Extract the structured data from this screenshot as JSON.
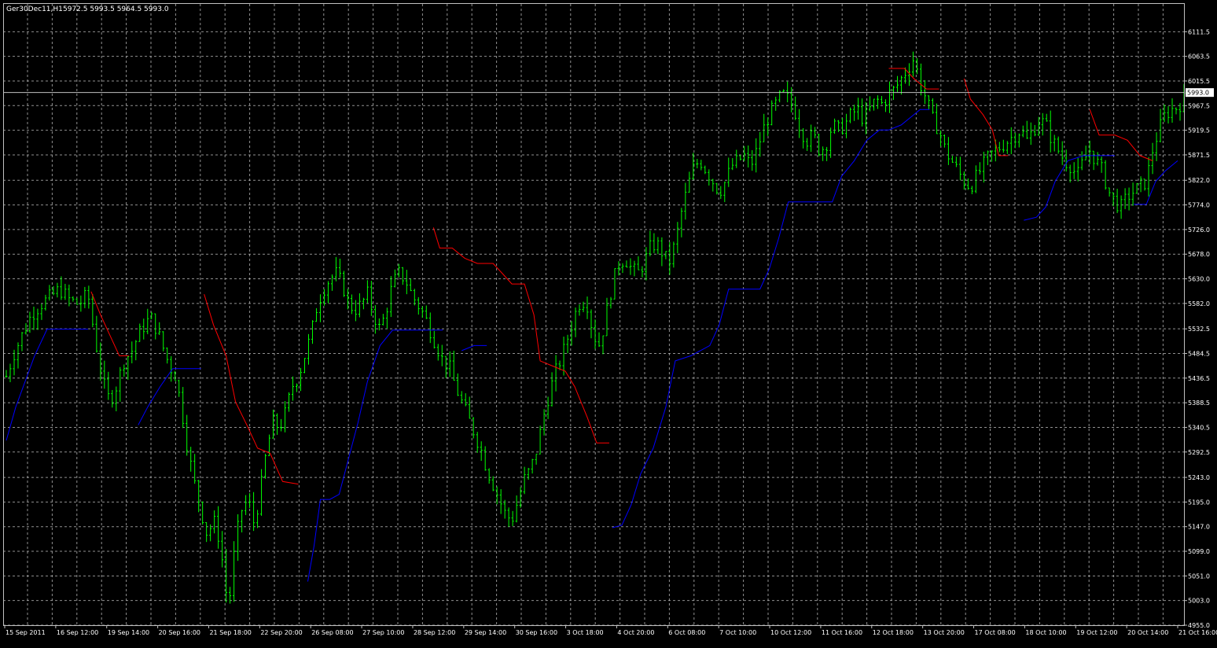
{
  "header": {
    "symbol": "Ger30Dec11,H1",
    "ohlc": "5972.5 5993.5 5964.5 5993.0"
  },
  "colors": {
    "background": "#000000",
    "grid": "#c0c0c0",
    "bars": "#00ff00",
    "bid_line": "#c0c0c0",
    "price_tag_bg": "#ffffff",
    "stop_up": "#0000ff",
    "stop_down": "#ff0000",
    "axis_text": "#ffffff"
  },
  "chart_data": {
    "type": "line",
    "title": "Ger30Dec11,H1",
    "timeframe": "H1",
    "ylim": [
      4955.0,
      6135.0
    ],
    "grid": true,
    "y_ticks": [
      "6111.5",
      "6063.5",
      "6015.5",
      "5967.5",
      "5919.5",
      "5871.5",
      "5822.0",
      "5774.0",
      "5726.0",
      "5678.0",
      "5630.0",
      "5582.0",
      "5532.5",
      "5484.5",
      "5436.5",
      "5388.5",
      "5340.5",
      "5292.5",
      "5243.0",
      "5195.0",
      "5147.0",
      "5099.0",
      "5051.0",
      "5003.0",
      "4955.0"
    ],
    "x_ticks": [
      "15 Sep 2011",
      "16 Sep 12:00",
      "19 Sep 14:00",
      "20 Sep 16:00",
      "21 Sep 18:00",
      "22 Sep 20:00",
      "26 Sep 08:00",
      "27 Sep 10:00",
      "28 Sep 12:00",
      "29 Sep 14:00",
      "30 Sep 16:00",
      "3 Oct 18:00",
      "4 Oct 20:00",
      "6 Oct 08:00",
      "7 Oct 10:00",
      "10 Oct 12:00",
      "11 Oct 16:00",
      "12 Oct 18:00",
      "13 Oct 20:00",
      "17 Oct 08:00",
      "18 Oct 10:00",
      "19 Oct 12:00",
      "20 Oct 14:00",
      "21 Oct 16:00"
    ],
    "current_price": "5993.0",
    "bar_count": 300,
    "close_path": [
      [
        0,
        5440
      ],
      [
        5,
        5485
      ],
      [
        10,
        5520
      ],
      [
        16,
        5560
      ],
      [
        22,
        5580
      ],
      [
        28,
        5595
      ],
      [
        34,
        5610
      ],
      [
        40,
        5590
      ],
      [
        46,
        5580
      ],
      [
        52,
        5600
      ],
      [
        57,
        5505
      ],
      [
        62,
        5425
      ],
      [
        66,
        5390
      ],
      [
        70,
        5420
      ],
      [
        75,
        5470
      ],
      [
        80,
        5490
      ],
      [
        84,
        5520
      ],
      [
        88,
        5540
      ],
      [
        92,
        5555
      ],
      [
        96,
        5530
      ],
      [
        100,
        5495
      ],
      [
        104,
        5460
      ],
      [
        108,
        5440
      ],
      [
        112,
        5370
      ],
      [
        116,
        5290
      ],
      [
        120,
        5230
      ],
      [
        124,
        5180
      ],
      [
        128,
        5130
      ],
      [
        132,
        5160
      ],
      [
        136,
        5120
      ],
      [
        140,
        5020
      ],
      [
        142,
        5000
      ],
      [
        146,
        5120
      ],
      [
        150,
        5180
      ],
      [
        154,
        5200
      ],
      [
        158,
        5150
      ],
      [
        162,
        5220
      ],
      [
        166,
        5300
      ],
      [
        170,
        5350
      ],
      [
        174,
        5340
      ],
      [
        178,
        5370
      ],
      [
        182,
        5420
      ],
      [
        186,
        5440
      ],
      [
        190,
        5480
      ],
      [
        194,
        5520
      ],
      [
        198,
        5580
      ],
      [
        202,
        5610
      ],
      [
        206,
        5630
      ],
      [
        210,
        5640
      ],
      [
        214,
        5620
      ],
      [
        218,
        5580
      ],
      [
        222,
        5570
      ],
      [
        226,
        5580
      ],
      [
        230,
        5600
      ],
      [
        234,
        5560
      ],
      [
        238,
        5530
      ],
      [
        242,
        5570
      ],
      [
        246,
        5620
      ],
      [
        250,
        5640
      ],
      [
        254,
        5630
      ],
      [
        258,
        5600
      ],
      [
        262,
        5580
      ],
      [
        266,
        5560
      ],
      [
        270,
        5530
      ],
      [
        274,
        5500
      ],
      [
        278,
        5470
      ],
      [
        282,
        5460
      ],
      [
        286,
        5420
      ],
      [
        290,
        5390
      ],
      [
        294,
        5360
      ],
      [
        298,
        5330
      ],
      [
        302,
        5300
      ],
      [
        306,
        5260
      ],
      [
        310,
        5230
      ],
      [
        314,
        5200
      ],
      [
        318,
        5170
      ],
      [
        322,
        5160
      ],
      [
        326,
        5200
      ],
      [
        330,
        5240
      ],
      [
        334,
        5260
      ],
      [
        338,
        5300
      ],
      [
        342,
        5360
      ],
      [
        346,
        5410
      ],
      [
        350,
        5450
      ],
      [
        354,
        5480
      ],
      [
        358,
        5520
      ],
      [
        362,
        5560
      ],
      [
        366,
        5590
      ],
      [
        370,
        5580
      ],
      [
        374,
        5520
      ],
      [
        378,
        5500
      ],
      [
        382,
        5560
      ],
      [
        386,
        5620
      ],
      [
        390,
        5660
      ],
      [
        394,
        5670
      ],
      [
        398,
        5650
      ],
      [
        402,
        5640
      ],
      [
        406,
        5660
      ],
      [
        410,
        5690
      ],
      [
        414,
        5700
      ],
      [
        418,
        5680
      ],
      [
        422,
        5660
      ],
      [
        426,
        5700
      ],
      [
        430,
        5760
      ],
      [
        434,
        5810
      ],
      [
        438,
        5850
      ],
      [
        442,
        5860
      ],
      [
        446,
        5840
      ],
      [
        450,
        5820
      ],
      [
        454,
        5800
      ],
      [
        458,
        5820
      ],
      [
        462,
        5850
      ],
      [
        466,
        5860
      ],
      [
        470,
        5870
      ],
      [
        474,
        5850
      ],
      [
        478,
        5880
      ],
      [
        482,
        5920
      ],
      [
        486,
        5950
      ],
      [
        490,
        5970
      ],
      [
        494,
        5990
      ],
      [
        498,
        5980
      ],
      [
        502,
        5960
      ],
      [
        506,
        5920
      ],
      [
        510,
        5900
      ],
      [
        514,
        5910
      ],
      [
        518,
        5880
      ],
      [
        522,
        5890
      ],
      [
        526,
        5930
      ],
      [
        530,
        5920
      ],
      [
        534,
        5930
      ],
      [
        538,
        5950
      ],
      [
        542,
        5960
      ],
      [
        546,
        5940
      ],
      [
        550,
        5960
      ],
      [
        554,
        5980
      ],
      [
        558,
        5970
      ],
      [
        562,
        5990
      ],
      [
        566,
        6000
      ],
      [
        570,
        6020
      ],
      [
        574,
        6040
      ],
      [
        578,
        6060
      ],
      [
        582,
        6010
      ],
      [
        586,
        5980
      ],
      [
        590,
        5940
      ],
      [
        594,
        5920
      ],
      [
        598,
        5880
      ],
      [
        602,
        5860
      ],
      [
        606,
        5840
      ],
      [
        610,
        5820
      ],
      [
        614,
        5810
      ],
      [
        618,
        5830
      ],
      [
        622,
        5850
      ],
      [
        626,
        5870
      ],
      [
        630,
        5880
      ],
      [
        634,
        5890
      ],
      [
        638,
        5900
      ],
      [
        642,
        5910
      ],
      [
        646,
        5920
      ],
      [
        650,
        5900
      ],
      [
        654,
        5920
      ],
      [
        658,
        5940
      ],
      [
        662,
        5930
      ],
      [
        666,
        5900
      ],
      [
        670,
        5880
      ],
      [
        674,
        5860
      ],
      [
        678,
        5850
      ],
      [
        682,
        5830
      ],
      [
        686,
        5860
      ],
      [
        690,
        5880
      ],
      [
        694,
        5860
      ],
      [
        698,
        5840
      ],
      [
        702,
        5800
      ],
      [
        706,
        5780
      ],
      [
        710,
        5770
      ],
      [
        714,
        5790
      ],
      [
        718,
        5800
      ],
      [
        722,
        5810
      ],
      [
        726,
        5820
      ],
      [
        730,
        5880
      ],
      [
        734,
        5920
      ],
      [
        738,
        5950
      ],
      [
        742,
        5960
      ],
      [
        746,
        5965
      ],
      [
        750,
        5980
      ]
    ],
    "series": [
      {
        "color": "#0000ff",
        "points": [
          [
            0,
            5315
          ],
          [
            6,
            5380
          ],
          [
            12,
            5430
          ],
          [
            18,
            5480
          ],
          [
            26,
            5532
          ],
          [
            40,
            5532
          ],
          [
            52,
            5532
          ]
        ]
      },
      {
        "color": "#ff0000",
        "points": [
          [
            54,
            5605
          ],
          [
            60,
            5560
          ],
          [
            66,
            5520
          ],
          [
            72,
            5480
          ],
          [
            78,
            5480
          ]
        ]
      },
      {
        "color": "#0000ff",
        "points": [
          [
            84,
            5345
          ],
          [
            90,
            5380
          ],
          [
            98,
            5420
          ],
          [
            106,
            5455
          ],
          [
            118,
            5455
          ],
          [
            124,
            5455
          ]
        ]
      },
      {
        "color": "#ff0000",
        "points": [
          [
            126,
            5600
          ],
          [
            132,
            5540
          ],
          [
            140,
            5480
          ],
          [
            146,
            5390
          ],
          [
            154,
            5340
          ],
          [
            160,
            5300
          ],
          [
            168,
            5290
          ],
          [
            176,
            5235
          ],
          [
            186,
            5230
          ]
        ]
      },
      {
        "color": "#0000ff",
        "points": [
          [
            192,
            5040
          ],
          [
            196,
            5110
          ],
          [
            200,
            5200
          ],
          [
            206,
            5200
          ],
          [
            212,
            5210
          ],
          [
            218,
            5280
          ],
          [
            224,
            5350
          ],
          [
            230,
            5430
          ],
          [
            238,
            5500
          ],
          [
            246,
            5530
          ],
          [
            254,
            5530
          ],
          [
            262,
            5530
          ],
          [
            270,
            5530
          ],
          [
            278,
            5530
          ]
        ]
      },
      {
        "color": "#ff0000",
        "points": [
          [
            272,
            5730
          ],
          [
            276,
            5690
          ],
          [
            284,
            5690
          ],
          [
            292,
            5670
          ],
          [
            300,
            5660
          ],
          [
            310,
            5660
          ],
          [
            316,
            5640
          ],
          [
            322,
            5620
          ],
          [
            330,
            5620
          ],
          [
            336,
            5560
          ],
          [
            340,
            5470
          ],
          [
            348,
            5460
          ],
          [
            356,
            5450
          ],
          [
            362,
            5420
          ],
          [
            370,
            5360
          ],
          [
            376,
            5310
          ],
          [
            384,
            5310
          ]
        ]
      },
      {
        "color": "#0000ff",
        "points": [
          [
            290,
            5490
          ],
          [
            298,
            5500
          ],
          [
            306,
            5500
          ]
        ]
      },
      {
        "color": "#0000ff",
        "points": [
          [
            386,
            5145
          ],
          [
            392,
            5150
          ],
          [
            398,
            5190
          ],
          [
            404,
            5250
          ],
          [
            412,
            5300
          ],
          [
            420,
            5380
          ],
          [
            426,
            5470
          ],
          [
            436,
            5480
          ],
          [
            442,
            5490
          ],
          [
            448,
            5500
          ],
          [
            454,
            5540
          ],
          [
            460,
            5610
          ],
          [
            470,
            5610
          ],
          [
            480,
            5610
          ],
          [
            486,
            5650
          ],
          [
            492,
            5710
          ],
          [
            498,
            5780
          ],
          [
            506,
            5780
          ],
          [
            514,
            5780
          ],
          [
            520,
            5780
          ],
          [
            526,
            5780
          ],
          [
            532,
            5830
          ],
          [
            540,
            5860
          ],
          [
            548,
            5900
          ],
          [
            556,
            5920
          ],
          [
            562,
            5920
          ],
          [
            570,
            5930
          ],
          [
            578,
            5950
          ],
          [
            582,
            5960
          ],
          [
            588,
            5960
          ]
        ]
      },
      {
        "color": "#ff0000",
        "points": [
          [
            562,
            6040
          ],
          [
            572,
            6040
          ],
          [
            578,
            6020
          ],
          [
            586,
            6000
          ],
          [
            594,
            6000
          ]
        ]
      },
      {
        "color": "#ff0000",
        "points": [
          [
            610,
            6020
          ],
          [
            614,
            5980
          ],
          [
            622,
            5950
          ],
          [
            628,
            5920
          ],
          [
            632,
            5870
          ],
          [
            638,
            5870
          ]
        ]
      },
      {
        "color": "#0000ff",
        "points": [
          [
            648,
            5744
          ],
          [
            656,
            5750
          ],
          [
            662,
            5770
          ],
          [
            668,
            5820
          ],
          [
            676,
            5860
          ],
          [
            686,
            5870
          ],
          [
            694,
            5870
          ],
          [
            700,
            5870
          ],
          [
            706,
            5870
          ]
        ]
      },
      {
        "color": "#ff0000",
        "points": [
          [
            690,
            5960
          ],
          [
            696,
            5910
          ],
          [
            706,
            5910
          ],
          [
            714,
            5900
          ],
          [
            722,
            5870
          ],
          [
            730,
            5860
          ]
        ]
      },
      {
        "color": "#0000ff",
        "points": [
          [
            718,
            5775
          ],
          [
            726,
            5775
          ],
          [
            732,
            5820
          ],
          [
            738,
            5840
          ],
          [
            746,
            5860
          ]
        ]
      }
    ]
  }
}
